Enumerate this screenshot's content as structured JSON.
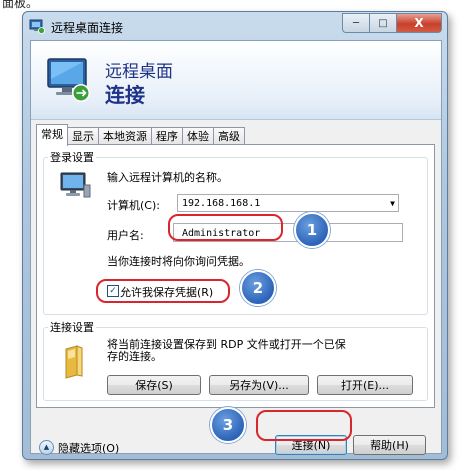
{
  "top_fragment": "面板。",
  "window": {
    "title": "远程桌面连接",
    "minimize_glyph": "─",
    "maximize_glyph": "□",
    "close_glyph": "X"
  },
  "banner": {
    "line1": "远程桌面",
    "line2": "连接"
  },
  "tabs": [
    "常规",
    "显示",
    "本地资源",
    "程序",
    "体验",
    "高级"
  ],
  "login": {
    "legend": "登录设置",
    "prompt": "输入远程计算机的名称。",
    "computer_label": "计算机(C):",
    "computer_value": "192.168.168.1",
    "username_label": "用户名:",
    "username_value": "Administrator",
    "credential_note": "当你连接时将向你询问凭据。",
    "allow_save_label": "允许我保存凭据(R)",
    "allow_save_checked": true
  },
  "conn_settings": {
    "legend": "连接设置",
    "description": "将当前连接设置保存到 RDP 文件或打开一个已保存的连接。",
    "save": "保存(S)",
    "save_as": "另存为(V)...",
    "open": "打开(E)..."
  },
  "footer": {
    "hide_options": "隐藏选项(O)",
    "connect": "连接(N)",
    "help": "帮助(H)"
  },
  "callouts": [
    "1",
    "2",
    "3"
  ],
  "colors": {
    "callout_red": "#d9262e",
    "badge_blue": "#2d63b8",
    "banner_text": "#1e3287"
  }
}
